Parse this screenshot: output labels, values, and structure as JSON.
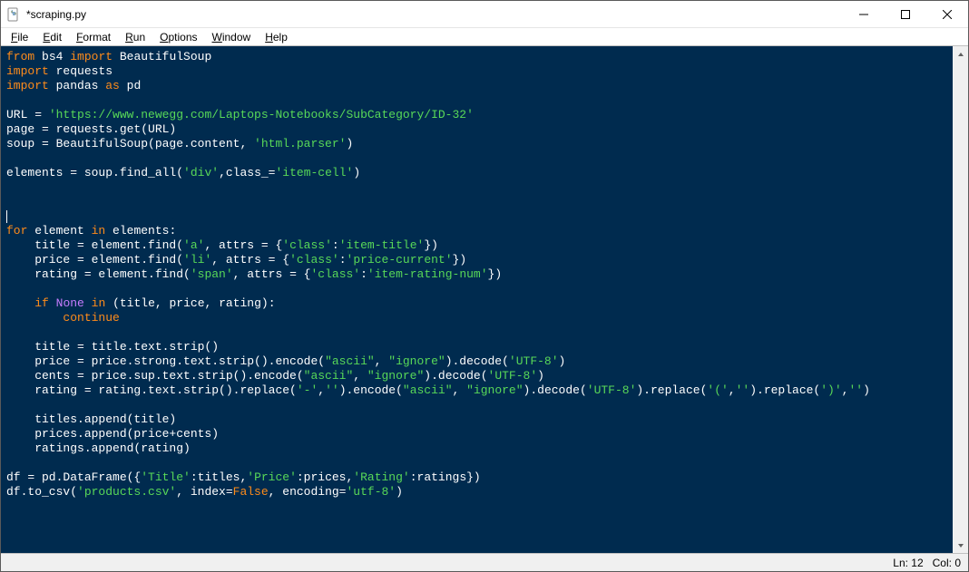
{
  "window": {
    "title": "*scraping.py"
  },
  "menu": {
    "file": "File",
    "edit": "Edit",
    "format": "Format",
    "run": "Run",
    "options": "Options",
    "window": "Window",
    "help": "Help"
  },
  "status": {
    "line_label": "Ln: 12",
    "col_label": "Col: 0"
  },
  "code": {
    "l1_from": "from",
    "l1_bs4": " bs4 ",
    "l1_import": "import",
    "l1_rest": " BeautifulSoup",
    "l2_import": "import",
    "l2_rest": " requests",
    "l3_import": "import",
    "l3_pandas": " pandas ",
    "l3_as": "as",
    "l3_pd": " pd",
    "l5a": "URL = ",
    "l5s": "'https://www.newegg.com/Laptops-Notebooks/SubCategory/ID-32'",
    "l6": "page = requests.get(URL)",
    "l7a": "soup = BeautifulSoup(page.content, ",
    "l7s": "'html.parser'",
    "l7b": ")",
    "l9a": "elements = soup.find_all(",
    "l9s1": "'div'",
    "l9b": ",class_=",
    "l9s2": "'item-cell'",
    "l9c": ")",
    "l13_for": "for",
    "l13_a": " element ",
    "l13_in": "in",
    "l13_b": " elements:",
    "l14a": "    title = element.find(",
    "l14s1": "'a'",
    "l14b": ", attrs = {",
    "l14s2": "'class'",
    "l14c": ":",
    "l14s3": "'item-title'",
    "l14d": "})",
    "l15a": "    price = element.find(",
    "l15s1": "'li'",
    "l15b": ", attrs = {",
    "l15s2": "'class'",
    "l15c": ":",
    "l15s3": "'price-current'",
    "l15d": "})",
    "l16a": "    rating = element.find(",
    "l16s1": "'span'",
    "l16b": ", attrs = {",
    "l16s2": "'class'",
    "l16c": ":",
    "l16s3": "'item-rating-num'",
    "l16d": "})",
    "l18a": "    ",
    "l18_if": "if",
    "l18b": " ",
    "l18_none": "None",
    "l18c": " ",
    "l18_in": "in",
    "l18d": " (title, price, rating):",
    "l19a": "        ",
    "l19_continue": "continue",
    "l21": "    title = title.text.strip()",
    "l22a": "    price = price.strong.text.strip().encode(",
    "l22s1": "\"ascii\"",
    "l22b": ", ",
    "l22s2": "\"ignore\"",
    "l22c": ").decode(",
    "l22s3": "'UTF-8'",
    "l22d": ")",
    "l23a": "    cents = price.sup.text.strip().encode(",
    "l23s1": "\"ascii\"",
    "l23b": ", ",
    "l23s2": "\"ignore\"",
    "l23c": ").decode(",
    "l23s3": "'UTF-8'",
    "l23d": ")",
    "l24a": "    rating = rating.text.strip().replace(",
    "l24s1": "'-'",
    "l24b": ",",
    "l24s2": "''",
    "l24c": ").encode(",
    "l24s3": "\"ascii\"",
    "l24d": ", ",
    "l24s4": "\"ignore\"",
    "l24e": ").decode(",
    "l24s5": "'UTF-8'",
    "l24f": ").replace(",
    "l24s6": "'('",
    "l24g": ",",
    "l24s7": "''",
    "l24h": ").replace(",
    "l24s8": "')'",
    "l24i": ",",
    "l24s9": "''",
    "l24j": ")",
    "l26": "    titles.append(title)",
    "l27": "    prices.append(price+cents)",
    "l28": "    ratings.append(rating)",
    "l30a": "df = pd.DataFrame({",
    "l30s1": "'Title'",
    "l30b": ":titles,",
    "l30s2": "'Price'",
    "l30c": ":prices,",
    "l30s3": "'Rating'",
    "l30d": ":ratings})",
    "l31a": "df.to_csv(",
    "l31s1": "'products.csv'",
    "l31b": ", index=",
    "l31_false": "False",
    "l31c": ", encoding=",
    "l31s2": "'utf-8'",
    "l31d": ")"
  }
}
